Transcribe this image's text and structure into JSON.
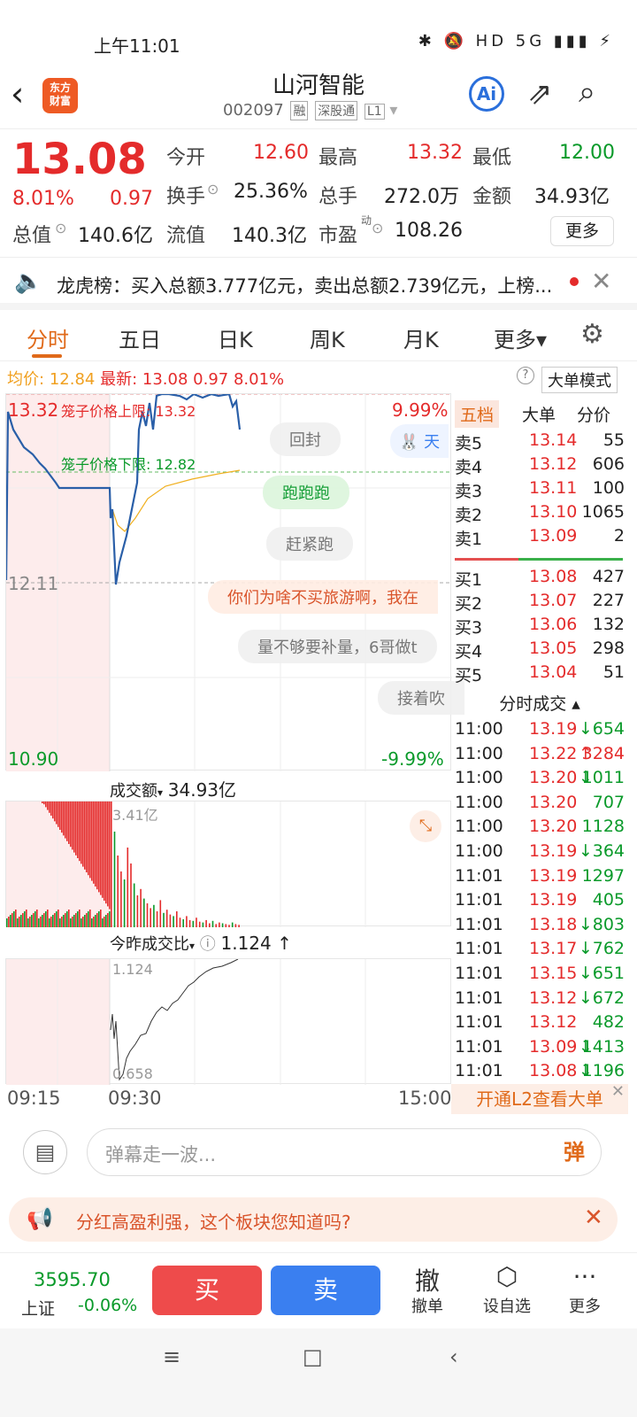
{
  "status": {
    "time": "上午11:01",
    "icons": "✱ 🔕 HD 5G ▮▮▮ ⚡"
  },
  "header": {
    "title": "山河智能",
    "logo": "东方\n财富",
    "code": "002097",
    "tags": [
      "融",
      "深股通",
      "L1"
    ],
    "ai": "Ai"
  },
  "quote": {
    "price": "13.08",
    "pct": "8.01%",
    "change": "0.97",
    "open_label": "今开",
    "open": "12.60",
    "high_label": "最高",
    "high": "13.32",
    "low_label": "最低",
    "low": "12.00",
    "turnover_label": "换手",
    "turnover": "25.36%",
    "volume_label": "总手",
    "volume": "272.0万",
    "amount_label": "金额",
    "amount": "34.93亿",
    "mktcap_label": "总值",
    "mktcap": "140.6亿",
    "float_label": "流值",
    "float_cap": "140.3亿",
    "pe_label": "市盈",
    "pe_sup": "动",
    "pe": "108.26",
    "more": "更多"
  },
  "notice": {
    "text": "龙虎榜：买入总额3.777亿元，卖出总额2.739亿元，上榜..."
  },
  "tabs": [
    "分时",
    "五日",
    "日K",
    "周K",
    "月K",
    "更多▾"
  ],
  "info": {
    "avg_label": "均价:",
    "avg": "12.84",
    "last_label": "最新:",
    "last": "13.08",
    "chg": "0.97",
    "pct": "8.01%",
    "mode": "大单模式"
  },
  "chart": {
    "top_price": "13.32",
    "top_pct": "9.99%",
    "mid_price": "12.11",
    "bottom_price": "10.90",
    "bottom_pct": "-9.99%",
    "upper_limit": "笼子价格上限: 13.32",
    "lower_limit": "笼子价格下限: 12.82",
    "danmu": [
      "回封",
      "跑跑跑",
      "赶紧跑",
      "你们为啥不买旅游啊，我在",
      "量不够要补量，6哥做t",
      "接着吹",
      "天"
    ]
  },
  "book": {
    "tabs": [
      "五档",
      "大单",
      "分价"
    ],
    "asks": [
      {
        "name": "卖5",
        "price": "13.14",
        "vol": "55"
      },
      {
        "name": "卖4",
        "price": "13.12",
        "vol": "606"
      },
      {
        "name": "卖3",
        "price": "13.11",
        "vol": "100"
      },
      {
        "name": "卖2",
        "price": "13.10",
        "vol": "1065"
      },
      {
        "name": "卖1",
        "price": "13.09",
        "vol": "2"
      }
    ],
    "bids": [
      {
        "name": "买1",
        "price": "13.08",
        "vol": "427"
      },
      {
        "name": "买2",
        "price": "13.07",
        "vol": "227"
      },
      {
        "name": "买3",
        "price": "13.06",
        "vol": "132"
      },
      {
        "name": "买4",
        "price": "13.05",
        "vol": "298"
      },
      {
        "name": "买5",
        "price": "13.04",
        "vol": "51"
      }
    ],
    "trades_title": "分时成交 ▴",
    "trades": [
      {
        "t": "11:00",
        "p": "13.19",
        "d": "↓",
        "v": "654"
      },
      {
        "t": "11:00",
        "p": "13.22",
        "d": "↑",
        "v": "3284"
      },
      {
        "t": "11:00",
        "p": "13.20",
        "d": "↓",
        "v": "1011"
      },
      {
        "t": "11:00",
        "p": "13.20",
        "d": "",
        "v": "707"
      },
      {
        "t": "11:00",
        "p": "13.20",
        "d": "",
        "v": "1128"
      },
      {
        "t": "11:00",
        "p": "13.19",
        "d": "↓",
        "v": "364"
      },
      {
        "t": "11:01",
        "p": "13.19",
        "d": "",
        "v": "1297"
      },
      {
        "t": "11:01",
        "p": "13.19",
        "d": "",
        "v": "405"
      },
      {
        "t": "11:01",
        "p": "13.18",
        "d": "↓",
        "v": "803"
      },
      {
        "t": "11:01",
        "p": "13.17",
        "d": "↓",
        "v": "762"
      },
      {
        "t": "11:01",
        "p": "13.15",
        "d": "↓",
        "v": "651"
      },
      {
        "t": "11:01",
        "p": "13.12",
        "d": "↓",
        "v": "672"
      },
      {
        "t": "11:01",
        "p": "13.12",
        "d": "",
        "v": "482"
      },
      {
        "t": "11:01",
        "p": "13.09",
        "d": "↓",
        "v": "1413"
      },
      {
        "t": "11:01",
        "p": "13.08",
        "d": "↓",
        "v": "1196"
      }
    ],
    "l2": "开通L2查看大单"
  },
  "volume": {
    "title": "成交额",
    "total": "34.93亿",
    "peak": "3.41亿"
  },
  "ratio": {
    "title": "今昨成交比",
    "value": "1.124 ↑",
    "max": "1.124",
    "min": "0.658"
  },
  "time_axis": [
    "09:15",
    "09:30",
    "15:00"
  ],
  "comment": {
    "placeholder": "弹幕走一波...",
    "btn": "弹"
  },
  "promo": {
    "text": "分红高盈利强，这个板块您知道吗?"
  },
  "bottom": {
    "index_value": "3595.70",
    "index_name": "上证",
    "index_chg": "-0.06%",
    "buy": "买",
    "sell": "卖",
    "actions": [
      {
        "icon": "撤",
        "label": "撤单"
      },
      {
        "icon": "⬡",
        "label": "设自选"
      },
      {
        "icon": "···",
        "label": "更多"
      }
    ]
  },
  "colors": {
    "up": "#e42b2b",
    "down": "#0a9a2a",
    "accent": "#e06a1a",
    "line": "#2a5fa8",
    "avg": "#f0b020"
  }
}
